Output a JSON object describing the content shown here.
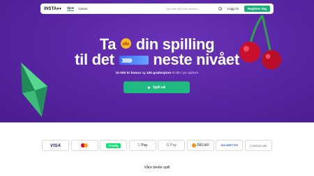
{
  "brand": {
    "logo_text": "INSTA♦♦",
    "accent_color": "#1bb07a",
    "hero_color": "#5a27a6"
  },
  "nav": {
    "links": [
      {
        "label": "Hjem",
        "active": true
      },
      {
        "label": "Casino",
        "active": false
      }
    ],
    "search": {
      "placeholder": "Søk etter spill eller studioer...",
      "icon": "search-icon"
    },
    "login_label": "Logg inn",
    "register_label": "Registrer deg"
  },
  "hero": {
    "headline_line1_before": "Ta",
    "headline_line1_after": "din spilling",
    "headline_line2_before": "til det",
    "headline_line2_after": "neste nivået",
    "bonus_amount": "10 000 kr bonus",
    "bonus_connector": "og",
    "bonus_spins": "100 gratisspinn",
    "bonus_suffix": "til alle nye spillere",
    "cta_label": "Spill nå"
  },
  "payments": [
    {
      "name": "visa",
      "label": "VISA"
    },
    {
      "name": "mastercard",
      "label": ""
    },
    {
      "name": "trustly",
      "label": "Trustly"
    },
    {
      "name": "apple-pay",
      "label": " Pay"
    },
    {
      "name": "google-pay",
      "label": "G Pay"
    },
    {
      "name": "bitcoin",
      "label": "bitcoin"
    },
    {
      "name": "muchbetter",
      "label": "MUCHBETTER"
    },
    {
      "name": "cashtocode",
      "label": "CashtoCode"
    }
  ],
  "games_section": {
    "title": "Våre beste spill"
  }
}
